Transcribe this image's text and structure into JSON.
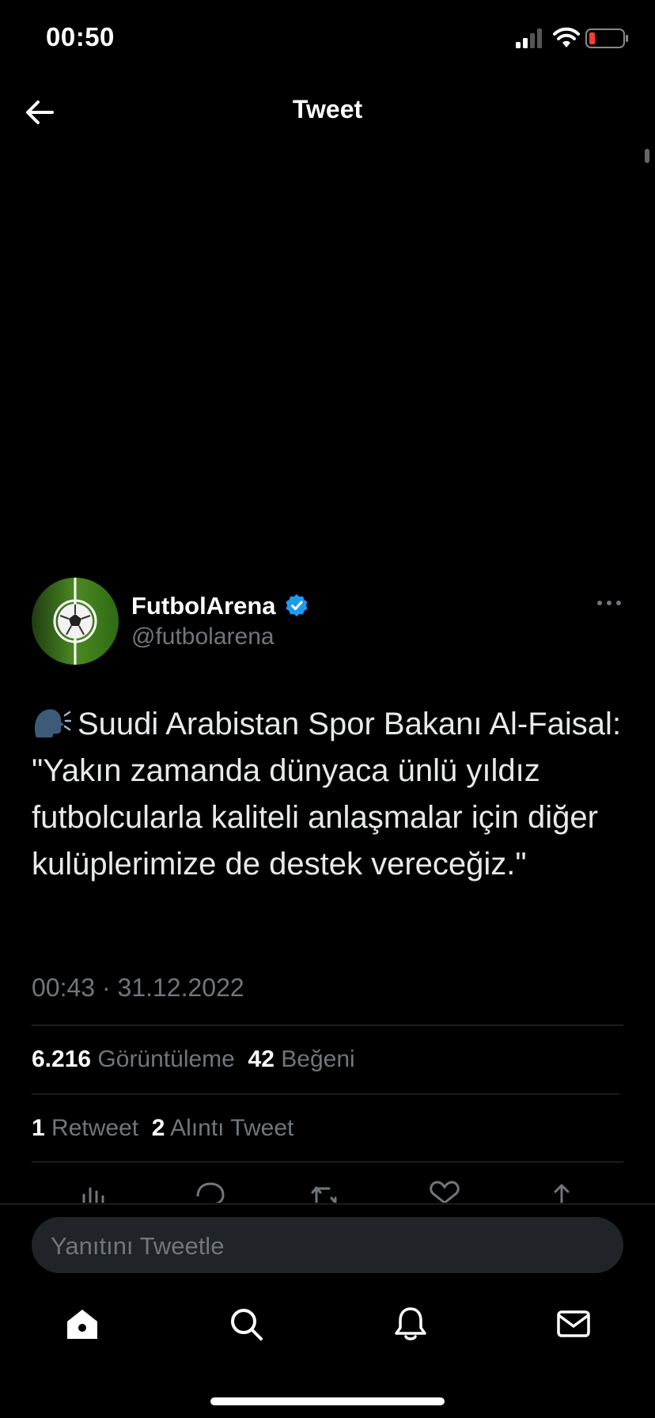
{
  "status_bar": {
    "time": "00:50"
  },
  "header": {
    "title": "Tweet"
  },
  "tweet": {
    "author_name": "FutbolArena",
    "author_handle": "@futbolarena",
    "emoji": "🗣️",
    "text": "Suudi Arabistan Spor Bakanı Al-Faisal: \"Yakın zamanda dünyaca ünlü yıldız futbolcularla kaliteli anlaşmalar için diğer kulüplerimize de destek vereceğiz.\"",
    "timestamp": "00:43 · 31.12.2022",
    "views_count": "6.216",
    "views_label": "Görüntüleme",
    "likes_count": "42",
    "likes_label": "Beğeni",
    "retweets_count": "1",
    "retweets_label": "Retweet",
    "quotes_count": "2",
    "quotes_label": "Alıntı Tweet"
  },
  "reply": {
    "placeholder": "Yanıtını Tweetle"
  },
  "icons": {
    "back": "arrow-left-icon",
    "verified": "verified-badge-icon",
    "more": "more-dots-icon",
    "tabs": [
      "home-icon",
      "search-icon",
      "notifications-icon",
      "messages-icon"
    ],
    "actions": [
      "analytics-icon",
      "reply-icon",
      "retweet-icon",
      "like-icon",
      "share-icon"
    ]
  },
  "colors": {
    "background": "#000000",
    "verified": "#1d9bf0",
    "muted_text": "#71767b",
    "reply_field": "#202327",
    "battery_low": "#ff3b30"
  }
}
